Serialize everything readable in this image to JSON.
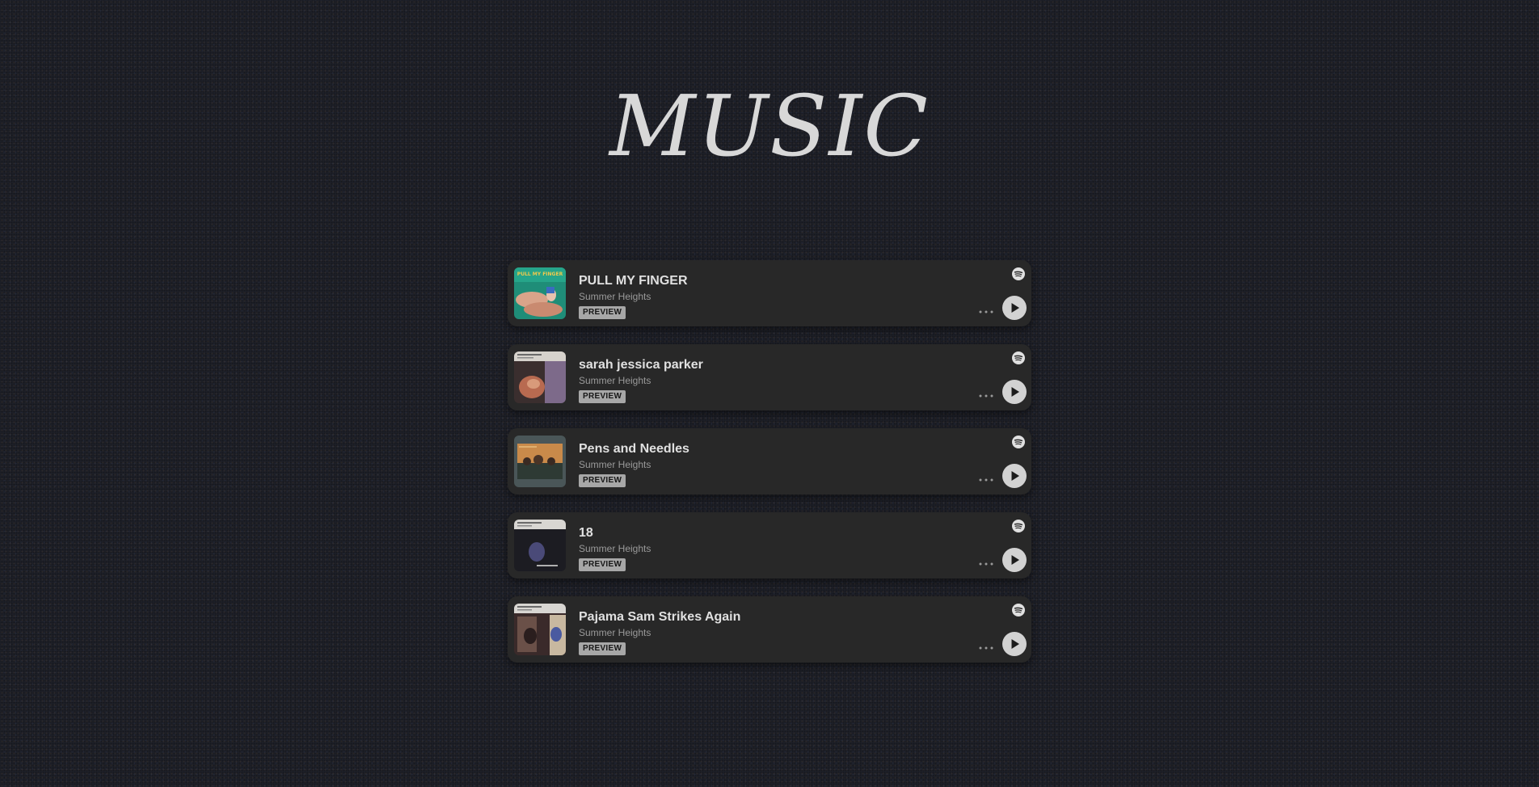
{
  "page": {
    "title": "MUSIC"
  },
  "tracks": [
    {
      "title": "PULL MY FINGER",
      "artist": "Summer Heights",
      "badge": "PREVIEW",
      "cover_icon": "album-cover-pull-my-finger"
    },
    {
      "title": "sarah jessica parker",
      "artist": "Summer Heights",
      "badge": "PREVIEW",
      "cover_icon": "album-cover-sarah-jessica-parker"
    },
    {
      "title": "Pens and Needles",
      "artist": "Summer Heights",
      "badge": "PREVIEW",
      "cover_icon": "album-cover-pens-and-needles"
    },
    {
      "title": "18",
      "artist": "Summer Heights",
      "badge": "PREVIEW",
      "cover_icon": "album-cover-18"
    },
    {
      "title": "Pajama Sam Strikes Again",
      "artist": "Summer Heights",
      "badge": "PREVIEW",
      "cover_icon": "album-cover-pajama-sam-strikes-again"
    }
  ],
  "colors": {
    "background": "#1d1f27",
    "card": "#282828",
    "title_text": "#d8d8d8",
    "badge": "#a7a7a7",
    "play_button": "#d2d2d2"
  },
  "icons": {
    "spotify": "spotify-icon",
    "more": "more-options-icon",
    "play": "play-icon"
  }
}
